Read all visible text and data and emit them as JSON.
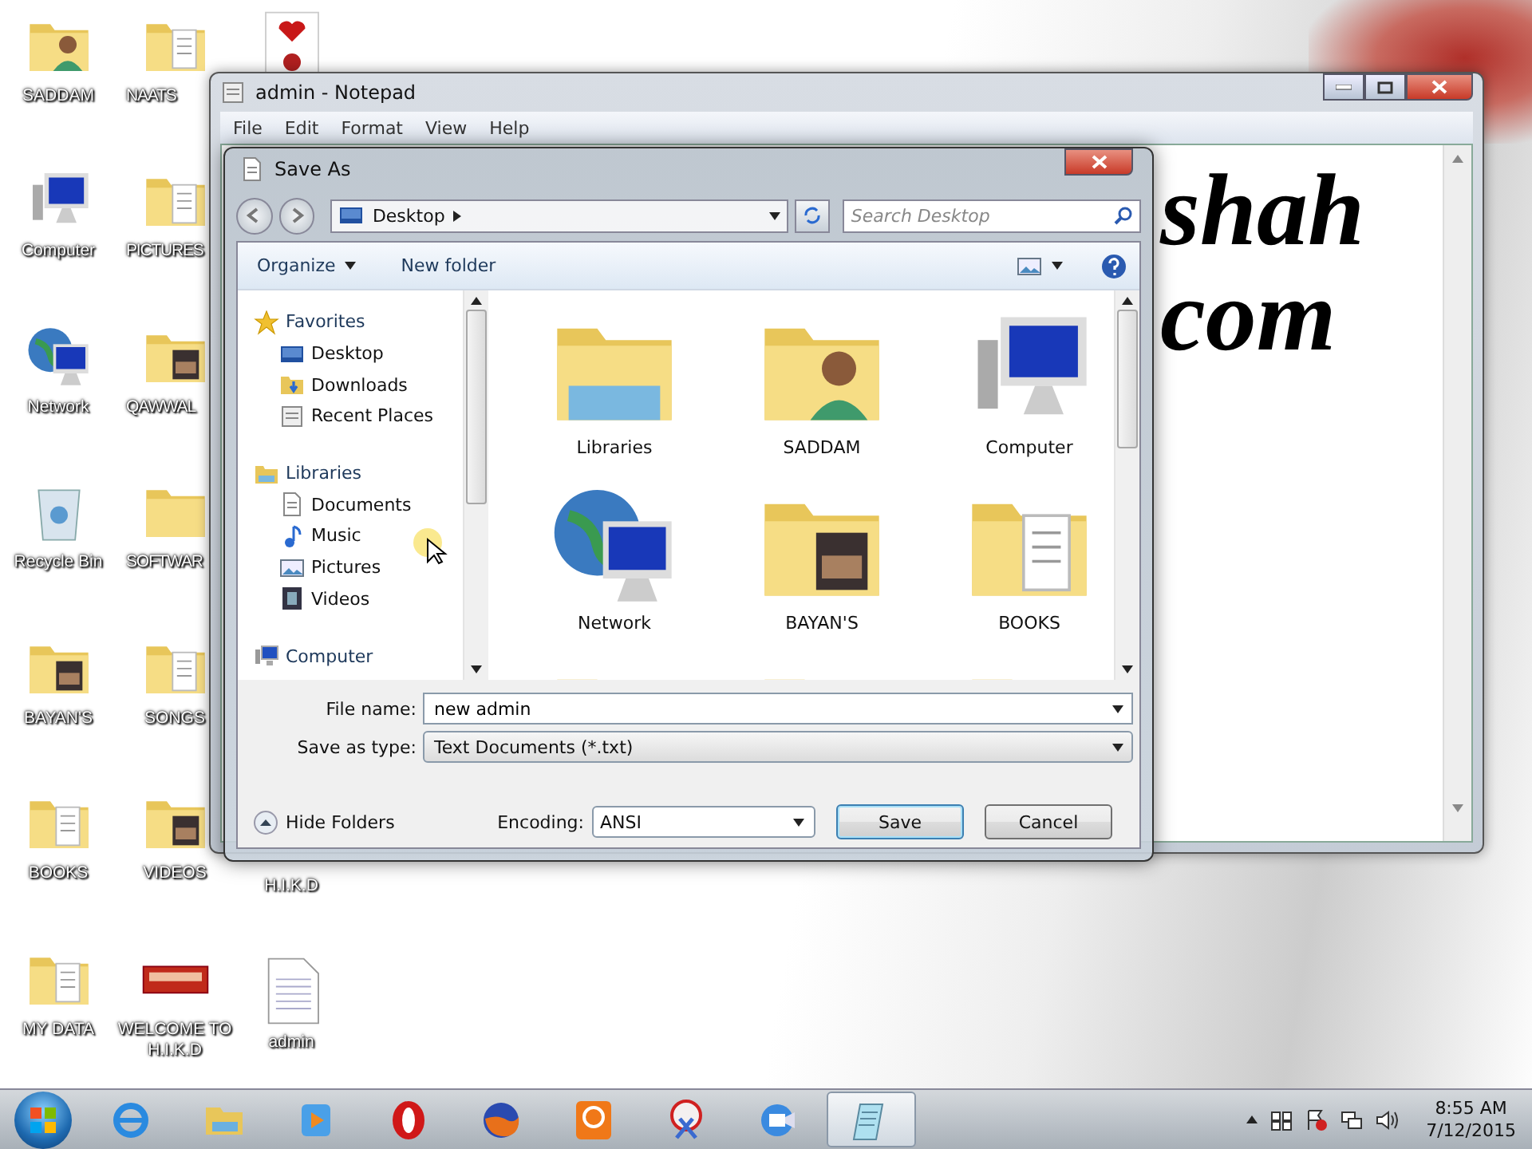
{
  "desktop": {
    "columns": [
      {
        "icons": [
          {
            "label": "SADDAM",
            "kind": "user-folder"
          },
          {
            "label": "Computer",
            "kind": "computer"
          },
          {
            "label": "Network",
            "kind": "network"
          },
          {
            "label": "Recycle Bin",
            "kind": "recycle"
          },
          {
            "label": "BAYAN'S",
            "kind": "photo-folder"
          },
          {
            "label": "BOOKS",
            "kind": "docs-folder"
          },
          {
            "label": "MY DATA",
            "kind": "docs-folder"
          }
        ]
      },
      {
        "icons": [
          {
            "label": "NAATS",
            "kind": "docs-folder"
          },
          {
            "label": "PICTURES",
            "kind": "docs-folder"
          },
          {
            "label": "QAWWAL",
            "kind": "photo-folder"
          },
          {
            "label": "SOFTWAR",
            "kind": "folder"
          },
          {
            "label": "SONGS",
            "kind": "docs-folder"
          },
          {
            "label": "VIDEOS",
            "kind": "photo-folder"
          },
          {
            "label": "WELCOME TO H.I.K.D",
            "kind": "banner"
          }
        ]
      },
      {
        "icons": [
          {
            "kind": "image"
          },
          {
            "label": "H.I.K.D",
            "kind": "covered"
          },
          {
            "label": "admin",
            "kind": "document"
          }
        ]
      }
    ]
  },
  "notepad": {
    "title": "admin - Notepad",
    "menu": [
      "File",
      "Edit",
      "Format",
      "View",
      "Help"
    ],
    "lines": [
      "shah",
      "com"
    ]
  },
  "dialog": {
    "title": "Save As",
    "address": "Desktop",
    "search": {
      "placeholder": "Search Desktop"
    },
    "toolbar": {
      "organize": "Organize",
      "new_folder": "New folder"
    },
    "nav": [
      {
        "label": "Favorites",
        "kind": "star",
        "children": [
          {
            "label": "Desktop",
            "kind": "desktop"
          },
          {
            "label": "Downloads",
            "kind": "downloads"
          },
          {
            "label": "Recent Places",
            "kind": "recent"
          }
        ]
      },
      {
        "label": "Libraries",
        "kind": "library",
        "children": [
          {
            "label": "Documents",
            "kind": "doc"
          },
          {
            "label": "Music",
            "kind": "music"
          },
          {
            "label": "Pictures",
            "kind": "pictures"
          },
          {
            "label": "Videos",
            "kind": "videos"
          }
        ]
      },
      {
        "label": "Computer",
        "kind": "pc"
      }
    ],
    "files": [
      {
        "label": "Libraries",
        "kind": "library"
      },
      {
        "label": "SADDAM",
        "kind": "user-folder"
      },
      {
        "label": "Computer",
        "kind": "computer"
      },
      {
        "label": "Network",
        "kind": "network"
      },
      {
        "label": "BAYAN'S",
        "kind": "photo-folder"
      },
      {
        "label": "BOOKS",
        "kind": "docs-folder"
      },
      {
        "kind": "folder"
      },
      {
        "kind": "folder"
      },
      {
        "kind": "folder"
      }
    ],
    "file_name": {
      "label": "File name:",
      "value": "new admin"
    },
    "save_as_type": {
      "label": "Save as type:",
      "value": "Text Documents (*.txt)"
    },
    "hide_folders": "Hide Folders",
    "encoding": {
      "label": "Encoding:",
      "value": "ANSI"
    },
    "buttons": [
      {
        "label": "Save",
        "kind": "default"
      },
      {
        "label": "Cancel",
        "kind": "normal"
      }
    ]
  },
  "taskbar": {
    "apps": [
      {
        "kind": "ie",
        "selected": false
      },
      {
        "kind": "explorer",
        "selected": false
      },
      {
        "kind": "media",
        "selected": false
      },
      {
        "kind": "opera",
        "selected": false
      },
      {
        "kind": "firefox",
        "selected": false
      },
      {
        "kind": "pdf",
        "selected": false
      },
      {
        "kind": "snipping",
        "selected": false
      },
      {
        "kind": "video",
        "selected": false
      },
      {
        "kind": "notepad",
        "selected": true
      }
    ],
    "time": "8:55 AM",
    "date": "7/12/2015"
  }
}
